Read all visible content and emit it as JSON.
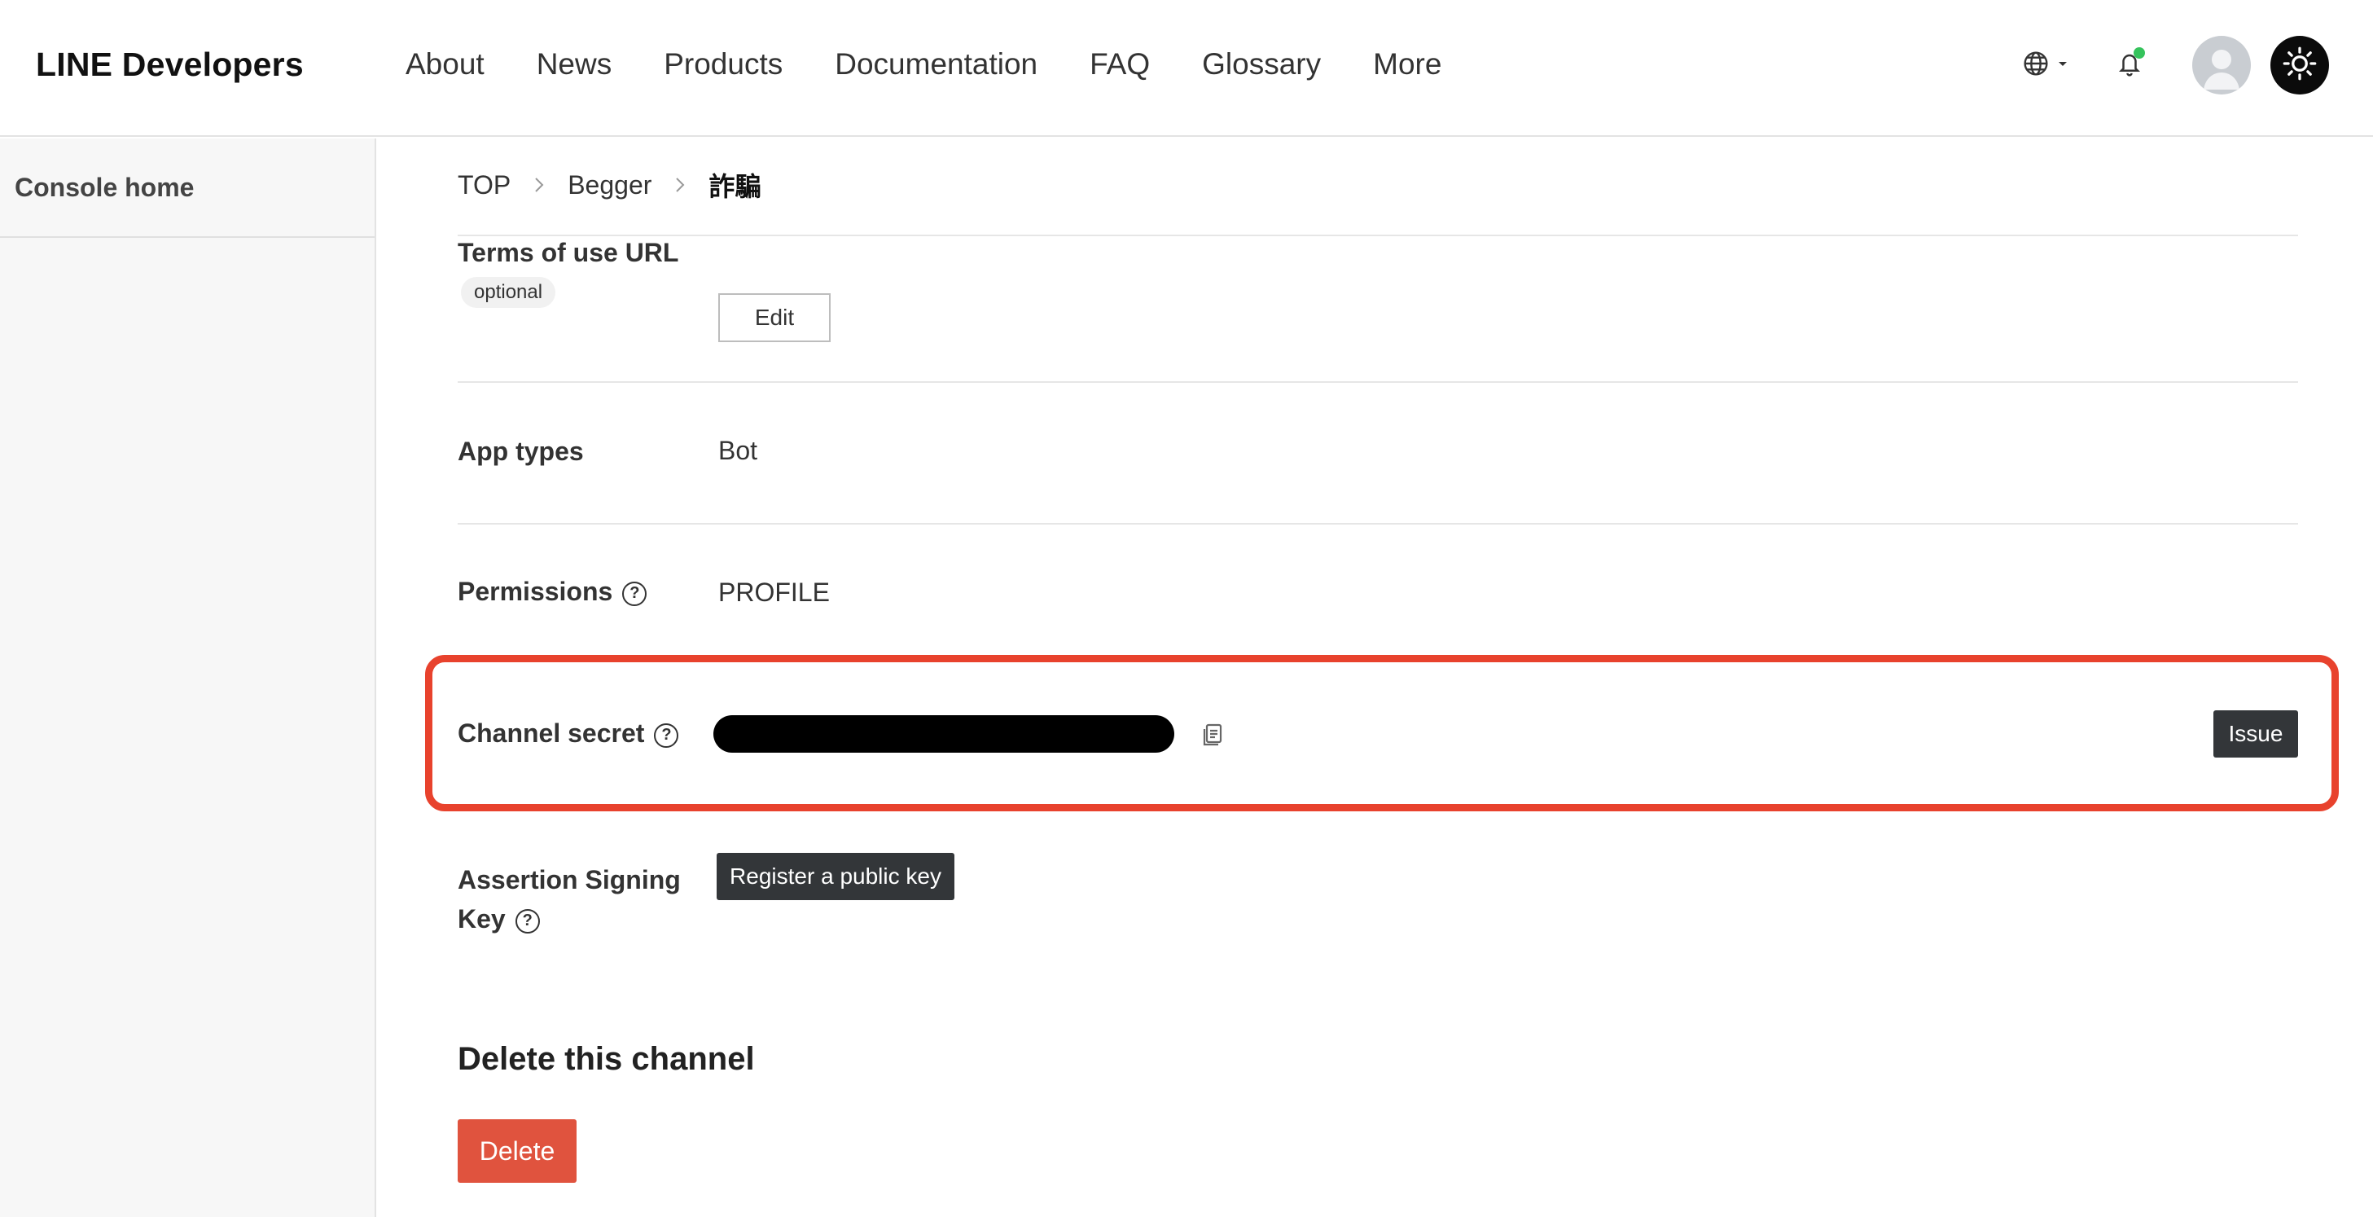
{
  "header": {
    "logo": "LINE Developers",
    "nav": [
      "About",
      "News",
      "Products",
      "Documentation",
      "FAQ",
      "Glossary",
      "More"
    ]
  },
  "sidebar": {
    "items": [
      {
        "label": "Console home"
      }
    ]
  },
  "breadcrumb": {
    "items": [
      "TOP",
      "Begger",
      "詐騙"
    ]
  },
  "settings": {
    "terms": {
      "label": "Terms of use URL",
      "badge": "optional",
      "button": "Edit"
    },
    "app_types": {
      "label": "App types",
      "value": "Bot"
    },
    "permissions": {
      "label": "Permissions",
      "value": "PROFILE"
    },
    "channel_secret": {
      "label": "Channel secret",
      "button": "Issue"
    },
    "assertion": {
      "label_line1": "Assertion Signing",
      "label_line2": "Key",
      "button": "Register a public key"
    }
  },
  "delete_section": {
    "title": "Delete this channel",
    "button": "Delete"
  },
  "colors": {
    "highlight": "#e8422d",
    "delete": "#e0533e",
    "dark_button": "#333639",
    "notification": "#35c35c"
  },
  "icons": [
    "globe-icon",
    "caret-down-icon",
    "bell-icon",
    "user-icon",
    "sun-icon",
    "chevron-right-icon",
    "question-icon",
    "copy-icon"
  ]
}
